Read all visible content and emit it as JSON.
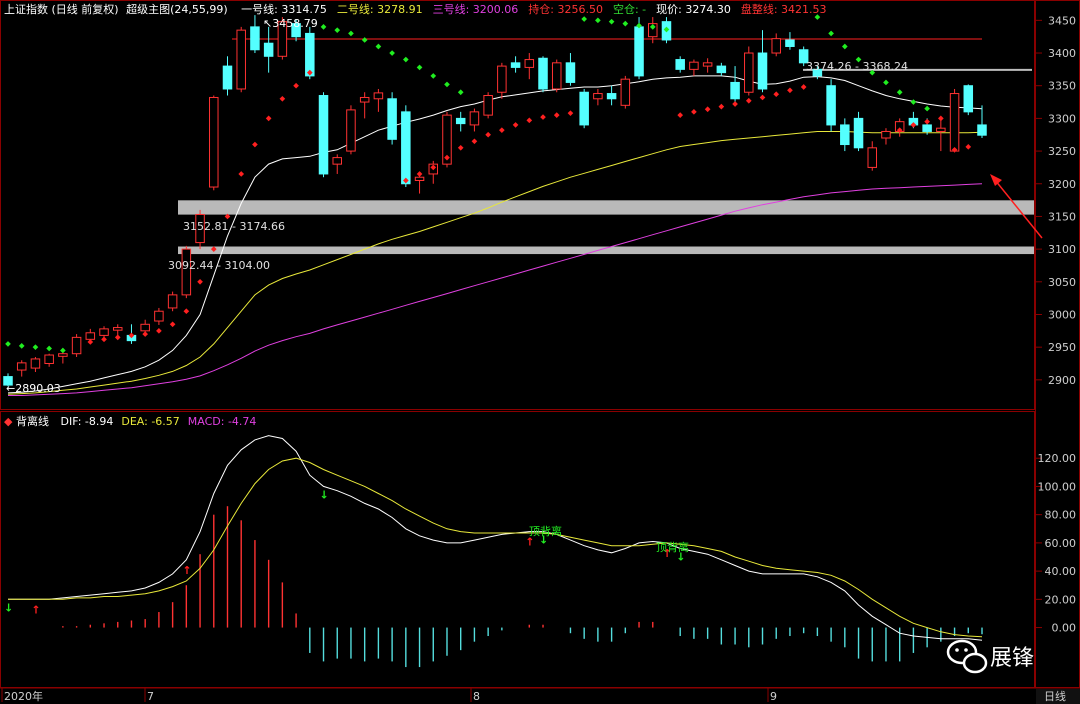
{
  "header": {
    "index_name": "上证指数",
    "period": "(日线 前复权)",
    "indicator": "超级主图(24,55,99)",
    "items": [
      {
        "label": "一号线: 3314.75",
        "color": "#ffffff"
      },
      {
        "label": "二号线: 3278.91",
        "color": "#e8e83a"
      },
      {
        "label": "三号线: 3200.06",
        "color": "#e040e0"
      },
      {
        "label": "持仓: 3256.50",
        "color": "#ff3333"
      },
      {
        "label": "空仓: -",
        "color": "#33dd33"
      },
      {
        "label": "现价: 3274.30",
        "color": "#ffffff"
      },
      {
        "label": "盘整线: 3421.53",
        "color": "#ff3333"
      }
    ]
  },
  "sub_header": {
    "name": "背离线",
    "items": [
      {
        "label": "DIF: -8.94",
        "color": "#ffffff"
      },
      {
        "label": "DEA: -6.57",
        "color": "#e8e83a"
      },
      {
        "label": "MACD: -4.74",
        "color": "#e040e0"
      }
    ]
  },
  "annotations": {
    "high": "3458.79",
    "low": "2890.03",
    "zone1": "3152.81 - 3174.66",
    "zone2": "3092.44 - 3104.00",
    "zone3": "3374.26 - 3368.24",
    "top_div1": "顶背离",
    "top_div2": "顶背离"
  },
  "x_axis": {
    "labels": [
      "2020年",
      "7",
      "8",
      "9"
    ],
    "period_button": "日线"
  },
  "watermark": "展锋",
  "colors": {
    "up": "#ff3232",
    "down": "#54ffff",
    "line1": "#ffffff",
    "line2": "#e8e83a",
    "line3": "#e040e0",
    "grid": "#8a0000",
    "dot_red": "#ff2020",
    "dot_green": "#20ee20"
  },
  "chart_data": [
    {
      "type": "candlestick",
      "title": "上证指数 (日线 前复权)",
      "y_ticks": [
        2900,
        2950,
        3000,
        3050,
        3100,
        3150,
        3200,
        3250,
        3300,
        3350,
        3400,
        3450
      ],
      "ylim": [
        2860,
        3475
      ],
      "candles": [
        {
          "o": 2905,
          "h": 2910,
          "l": 2890,
          "c": 2892
        },
        {
          "o": 2915,
          "h": 2930,
          "l": 2905,
          "c": 2926
        },
        {
          "o": 2918,
          "h": 2935,
          "l": 2912,
          "c": 2932
        },
        {
          "o": 2925,
          "h": 2940,
          "l": 2920,
          "c": 2938
        },
        {
          "o": 2936,
          "h": 2942,
          "l": 2925,
          "c": 2940
        },
        {
          "o": 2940,
          "h": 2970,
          "l": 2935,
          "c": 2965
        },
        {
          "o": 2962,
          "h": 2978,
          "l": 2955,
          "c": 2972
        },
        {
          "o": 2968,
          "h": 2982,
          "l": 2960,
          "c": 2978
        },
        {
          "o": 2976,
          "h": 2985,
          "l": 2966,
          "c": 2980
        },
        {
          "o": 2968,
          "h": 2985,
          "l": 2955,
          "c": 2960
        },
        {
          "o": 2975,
          "h": 2992,
          "l": 2968,
          "c": 2985
        },
        {
          "o": 2990,
          "h": 3010,
          "l": 2984,
          "c": 3005
        },
        {
          "o": 3010,
          "h": 3035,
          "l": 3005,
          "c": 3030
        },
        {
          "o": 3030,
          "h": 3105,
          "l": 3025,
          "c": 3100
        },
        {
          "o": 3110,
          "h": 3160,
          "l": 3100,
          "c": 3153
        },
        {
          "o": 3195,
          "h": 3335,
          "l": 3190,
          "c": 3332
        },
        {
          "o": 3380,
          "h": 3395,
          "l": 3335,
          "c": 3345
        },
        {
          "o": 3345,
          "h": 3440,
          "l": 3340,
          "c": 3435
        },
        {
          "o": 3440,
          "h": 3458,
          "l": 3400,
          "c": 3405
        },
        {
          "o": 3415,
          "h": 3440,
          "l": 3370,
          "c": 3395
        },
        {
          "o": 3395,
          "h": 3455,
          "l": 3390,
          "c": 3448
        },
        {
          "o": 3445,
          "h": 3452,
          "l": 3418,
          "c": 3425
        },
        {
          "o": 3430,
          "h": 3440,
          "l": 3360,
          "c": 3365
        },
        {
          "o": 3335,
          "h": 3340,
          "l": 3210,
          "c": 3215
        },
        {
          "o": 3230,
          "h": 3245,
          "l": 3215,
          "c": 3240
        },
        {
          "o": 3250,
          "h": 3320,
          "l": 3245,
          "c": 3313
        },
        {
          "o": 3325,
          "h": 3340,
          "l": 3300,
          "c": 3332
        },
        {
          "o": 3330,
          "h": 3345,
          "l": 3310,
          "c": 3339
        },
        {
          "o": 3330,
          "h": 3340,
          "l": 3260,
          "c": 3268
        },
        {
          "o": 3310,
          "h": 3320,
          "l": 3195,
          "c": 3200
        },
        {
          "o": 3205,
          "h": 3215,
          "l": 3185,
          "c": 3210
        },
        {
          "o": 3215,
          "h": 3235,
          "l": 3200,
          "c": 3230
        },
        {
          "o": 3230,
          "h": 3310,
          "l": 3225,
          "c": 3305
        },
        {
          "o": 3300,
          "h": 3310,
          "l": 3280,
          "c": 3292
        },
        {
          "o": 3290,
          "h": 3315,
          "l": 3280,
          "c": 3310
        },
        {
          "o": 3305,
          "h": 3340,
          "l": 3300,
          "c": 3335
        },
        {
          "o": 3340,
          "h": 3385,
          "l": 3330,
          "c": 3380
        },
        {
          "o": 3385,
          "h": 3395,
          "l": 3370,
          "c": 3378
        },
        {
          "o": 3378,
          "h": 3400,
          "l": 3360,
          "c": 3390
        },
        {
          "o": 3392,
          "h": 3395,
          "l": 3340,
          "c": 3345
        },
        {
          "o": 3345,
          "h": 3390,
          "l": 3340,
          "c": 3385
        },
        {
          "o": 3385,
          "h": 3400,
          "l": 3350,
          "c": 3355
        },
        {
          "o": 3340,
          "h": 3345,
          "l": 3285,
          "c": 3290
        },
        {
          "o": 3330,
          "h": 3345,
          "l": 3320,
          "c": 3338
        },
        {
          "o": 3338,
          "h": 3350,
          "l": 3320,
          "c": 3330
        },
        {
          "o": 3320,
          "h": 3365,
          "l": 3315,
          "c": 3360
        },
        {
          "o": 3440,
          "h": 3455,
          "l": 3360,
          "c": 3365
        },
        {
          "o": 3425,
          "h": 3455,
          "l": 3415,
          "c": 3445
        },
        {
          "o": 3448,
          "h": 3455,
          "l": 3415,
          "c": 3420
        },
        {
          "o": 3390,
          "h": 3395,
          "l": 3370,
          "c": 3375
        },
        {
          "o": 3375,
          "h": 3390,
          "l": 3365,
          "c": 3386
        },
        {
          "o": 3380,
          "h": 3392,
          "l": 3370,
          "c": 3385
        },
        {
          "o": 3380,
          "h": 3385,
          "l": 3365,
          "c": 3370
        },
        {
          "o": 3355,
          "h": 3380,
          "l": 3325,
          "c": 3330
        },
        {
          "o": 3340,
          "h": 3410,
          "l": 3335,
          "c": 3400
        },
        {
          "o": 3400,
          "h": 3435,
          "l": 3340,
          "c": 3345
        },
        {
          "o": 3400,
          "h": 3430,
          "l": 3395,
          "c": 3422
        },
        {
          "o": 3420,
          "h": 3432,
          "l": 3405,
          "c": 3410
        },
        {
          "o": 3405,
          "h": 3410,
          "l": 3380,
          "c": 3385
        },
        {
          "o": 3375,
          "h": 3380,
          "l": 3360,
          "c": 3365
        },
        {
          "o": 3350,
          "h": 3360,
          "l": 3280,
          "c": 3290
        },
        {
          "o": 3290,
          "h": 3300,
          "l": 3250,
          "c": 3260
        },
        {
          "o": 3300,
          "h": 3310,
          "l": 3250,
          "c": 3255
        },
        {
          "o": 3225,
          "h": 3265,
          "l": 3220,
          "c": 3255
        },
        {
          "o": 3270,
          "h": 3285,
          "l": 3260,
          "c": 3280
        },
        {
          "o": 3280,
          "h": 3300,
          "l": 3272,
          "c": 3295
        },
        {
          "o": 3300,
          "h": 3310,
          "l": 3285,
          "c": 3290
        },
        {
          "o": 3290,
          "h": 3300,
          "l": 3275,
          "c": 3280
        },
        {
          "o": 3280,
          "h": 3300,
          "l": 3250,
          "c": 3285
        },
        {
          "o": 3250,
          "h": 3345,
          "l": 3248,
          "c": 3338
        },
        {
          "o": 3350,
          "h": 3352,
          "l": 3305,
          "c": 3310
        },
        {
          "o": 3290,
          "h": 3320,
          "l": 3270,
          "c": 3274.3
        }
      ],
      "line1": [
        2880,
        2881,
        2883,
        2886,
        2890,
        2894,
        2898,
        2903,
        2908,
        2913,
        2920,
        2930,
        2945,
        2968,
        3000,
        3060,
        3120,
        3170,
        3210,
        3230,
        3238,
        3240,
        3242,
        3248,
        3252,
        3262,
        3272,
        3282,
        3288,
        3294,
        3299,
        3305,
        3312,
        3318,
        3322,
        3328,
        3333,
        3336,
        3339,
        3342,
        3344,
        3346,
        3348,
        3348,
        3350,
        3353,
        3356,
        3360,
        3362,
        3363,
        3365,
        3365,
        3365,
        3363,
        3357,
        3352,
        3353,
        3357,
        3363,
        3364,
        3362,
        3358,
        3350,
        3342,
        3335,
        3330,
        3326,
        3322,
        3319,
        3317,
        3316,
        3314.75
      ],
      "line2": [
        2878,
        2879,
        2880,
        2882,
        2884,
        2886,
        2889,
        2892,
        2895,
        2898,
        2902,
        2907,
        2913,
        2922,
        2935,
        2955,
        2980,
        3005,
        3030,
        3045,
        3055,
        3062,
        3068,
        3076,
        3084,
        3092,
        3100,
        3108,
        3115,
        3121,
        3127,
        3134,
        3141,
        3148,
        3155,
        3163,
        3172,
        3180,
        3188,
        3196,
        3203,
        3210,
        3216,
        3222,
        3228,
        3234,
        3240,
        3246,
        3252,
        3257,
        3260,
        3263,
        3266,
        3268,
        3270,
        3272,
        3274,
        3276,
        3278,
        3280,
        3280,
        3280,
        3279,
        3278,
        3278,
        3278,
        3278,
        3278,
        3278,
        3278,
        3278,
        3278.91
      ],
      "line3": [
        2876,
        2876,
        2877,
        2878,
        2879,
        2880,
        2882,
        2884,
        2886,
        2888,
        2891,
        2894,
        2897,
        2901,
        2906,
        2914,
        2923,
        2933,
        2944,
        2953,
        2960,
        2966,
        2971,
        2978,
        2984,
        2990,
        2996,
        3002,
        3008,
        3014,
        3020,
        3026,
        3032,
        3038,
        3044,
        3050,
        3056,
        3062,
        3068,
        3074,
        3080,
        3086,
        3092,
        3098,
        3104,
        3110,
        3116,
        3122,
        3128,
        3134,
        3140,
        3146,
        3152,
        3158,
        3163,
        3168,
        3172,
        3176,
        3180,
        3183,
        3186,
        3188,
        3190,
        3192,
        3193,
        3194,
        3195,
        3196,
        3197,
        3198,
        3199,
        3200.06
      ],
      "dots_red": [
        [
          6,
          2958
        ],
        [
          7,
          2962
        ],
        [
          8,
          2965
        ],
        [
          9,
          2968
        ],
        [
          10,
          2970
        ],
        [
          11,
          2975
        ],
        [
          12,
          2985
        ],
        [
          13,
          3005
        ],
        [
          14,
          3050
        ],
        [
          15,
          3100
        ],
        [
          16,
          3150
        ],
        [
          17,
          3215
        ],
        [
          18,
          3260
        ],
        [
          19,
          3300
        ],
        [
          20,
          3330
        ],
        [
          21,
          3350
        ],
        [
          22,
          3370
        ],
        [
          29,
          3205
        ],
        [
          30,
          3215
        ],
        [
          31,
          3225
        ],
        [
          32,
          3240
        ],
        [
          33,
          3255
        ],
        [
          34,
          3265
        ],
        [
          35,
          3275
        ],
        [
          36,
          3282
        ],
        [
          37,
          3290
        ],
        [
          38,
          3297
        ],
        [
          39,
          3302
        ],
        [
          40,
          3305
        ],
        [
          41,
          3308
        ],
        [
          49,
          3305
        ],
        [
          50,
          3310
        ],
        [
          51,
          3314
        ],
        [
          52,
          3318
        ],
        [
          53,
          3322
        ],
        [
          54,
          3327
        ],
        [
          55,
          3332
        ],
        [
          56,
          3337
        ],
        [
          57,
          3343
        ],
        [
          58,
          3348
        ],
        [
          65,
          3282
        ],
        [
          66,
          3290
        ],
        [
          67,
          3295
        ],
        [
          68,
          3300
        ],
        [
          69,
          3252
        ],
        [
          70,
          3256.5
        ]
      ],
      "dots_green": [
        [
          0,
          2955
        ],
        [
          1,
          2952
        ],
        [
          2,
          2950
        ],
        [
          3,
          2948
        ],
        [
          4,
          2945
        ],
        [
          23,
          3440
        ],
        [
          24,
          3435
        ],
        [
          25,
          3430
        ],
        [
          26,
          3420
        ],
        [
          27,
          3410
        ],
        [
          28,
          3400
        ],
        [
          29,
          3390
        ],
        [
          30,
          3378
        ],
        [
          31,
          3365
        ],
        [
          32,
          3352
        ],
        [
          33,
          3340
        ],
        [
          42,
          3452
        ],
        [
          43,
          3450
        ],
        [
          44,
          3448
        ],
        [
          45,
          3445
        ],
        [
          46,
          3442
        ],
        [
          47,
          3440
        ],
        [
          48,
          3436
        ],
        [
          59,
          3455
        ],
        [
          60,
          3430
        ],
        [
          61,
          3410
        ],
        [
          62,
          3390
        ],
        [
          63,
          3370
        ],
        [
          64,
          3355
        ],
        [
          65,
          3340
        ],
        [
          66,
          3325
        ],
        [
          67,
          3315
        ]
      ],
      "resistance_level": 3421.53,
      "zones": [
        [
          3152.81,
          3174.66
        ],
        [
          3092.44,
          3104.0
        ]
      ],
      "short_level": [
        3374.26,
        3368.24
      ]
    },
    {
      "type": "line",
      "title": "背离线",
      "y_ticks": [
        0,
        20,
        40,
        60,
        80,
        100,
        120
      ],
      "ylim": [
        -40,
        140
      ],
      "dif": [
        20,
        20,
        20,
        20,
        21,
        22,
        23,
        24,
        25,
        26,
        28,
        32,
        38,
        48,
        68,
        95,
        115,
        126,
        133,
        136,
        134,
        125,
        108,
        100,
        97,
        93,
        88,
        84,
        78,
        70,
        65,
        62,
        60,
        60,
        62,
        64,
        66,
        67,
        68,
        68,
        66,
        62,
        58,
        55,
        53,
        56,
        60,
        61,
        60,
        56,
        54,
        52,
        48,
        44,
        40,
        38,
        38,
        38,
        38,
        36,
        32,
        26,
        16,
        8,
        2,
        -4,
        -6,
        -7,
        -8,
        -8,
        -8,
        -8.94
      ],
      "dea": [
        20,
        20,
        20,
        20,
        20,
        21,
        21,
        22,
        22,
        23,
        24,
        26,
        29,
        33,
        42,
        55,
        72,
        88,
        102,
        112,
        118,
        120,
        117,
        112,
        108,
        104,
        100,
        95,
        90,
        84,
        79,
        74,
        70,
        68,
        67,
        67,
        67,
        67,
        67,
        67,
        66,
        64,
        62,
        60,
        58,
        58,
        58,
        59,
        60,
        59,
        58,
        56,
        54,
        50,
        47,
        44,
        42,
        41,
        40,
        39,
        37,
        33,
        27,
        20,
        14,
        8,
        3,
        0,
        -3,
        -5,
        -6,
        -6.57
      ],
      "macd": [
        0,
        0,
        0,
        0,
        1,
        1,
        2,
        3,
        4,
        5,
        6,
        11,
        18,
        30,
        52,
        80,
        86,
        76,
        62,
        48,
        32,
        10,
        -18,
        -24,
        -22,
        -22,
        -24,
        -22,
        -24,
        -28,
        -28,
        -24,
        -20,
        -16,
        -10,
        -6,
        -2,
        0,
        2,
        2,
        0,
        -4,
        -8,
        -10,
        -10,
        -4,
        4,
        4,
        0,
        -6,
        -8,
        -8,
        -12,
        -12,
        -14,
        -12,
        -8,
        -6,
        -4,
        -6,
        -10,
        -14,
        -22,
        -24,
        -24,
        -24,
        -18,
        -14,
        -10,
        -6,
        -4,
        -4.74
      ],
      "up_arrows": [
        2,
        13,
        38,
        48
      ],
      "down_arrows": [
        0,
        23,
        39,
        49
      ]
    }
  ]
}
